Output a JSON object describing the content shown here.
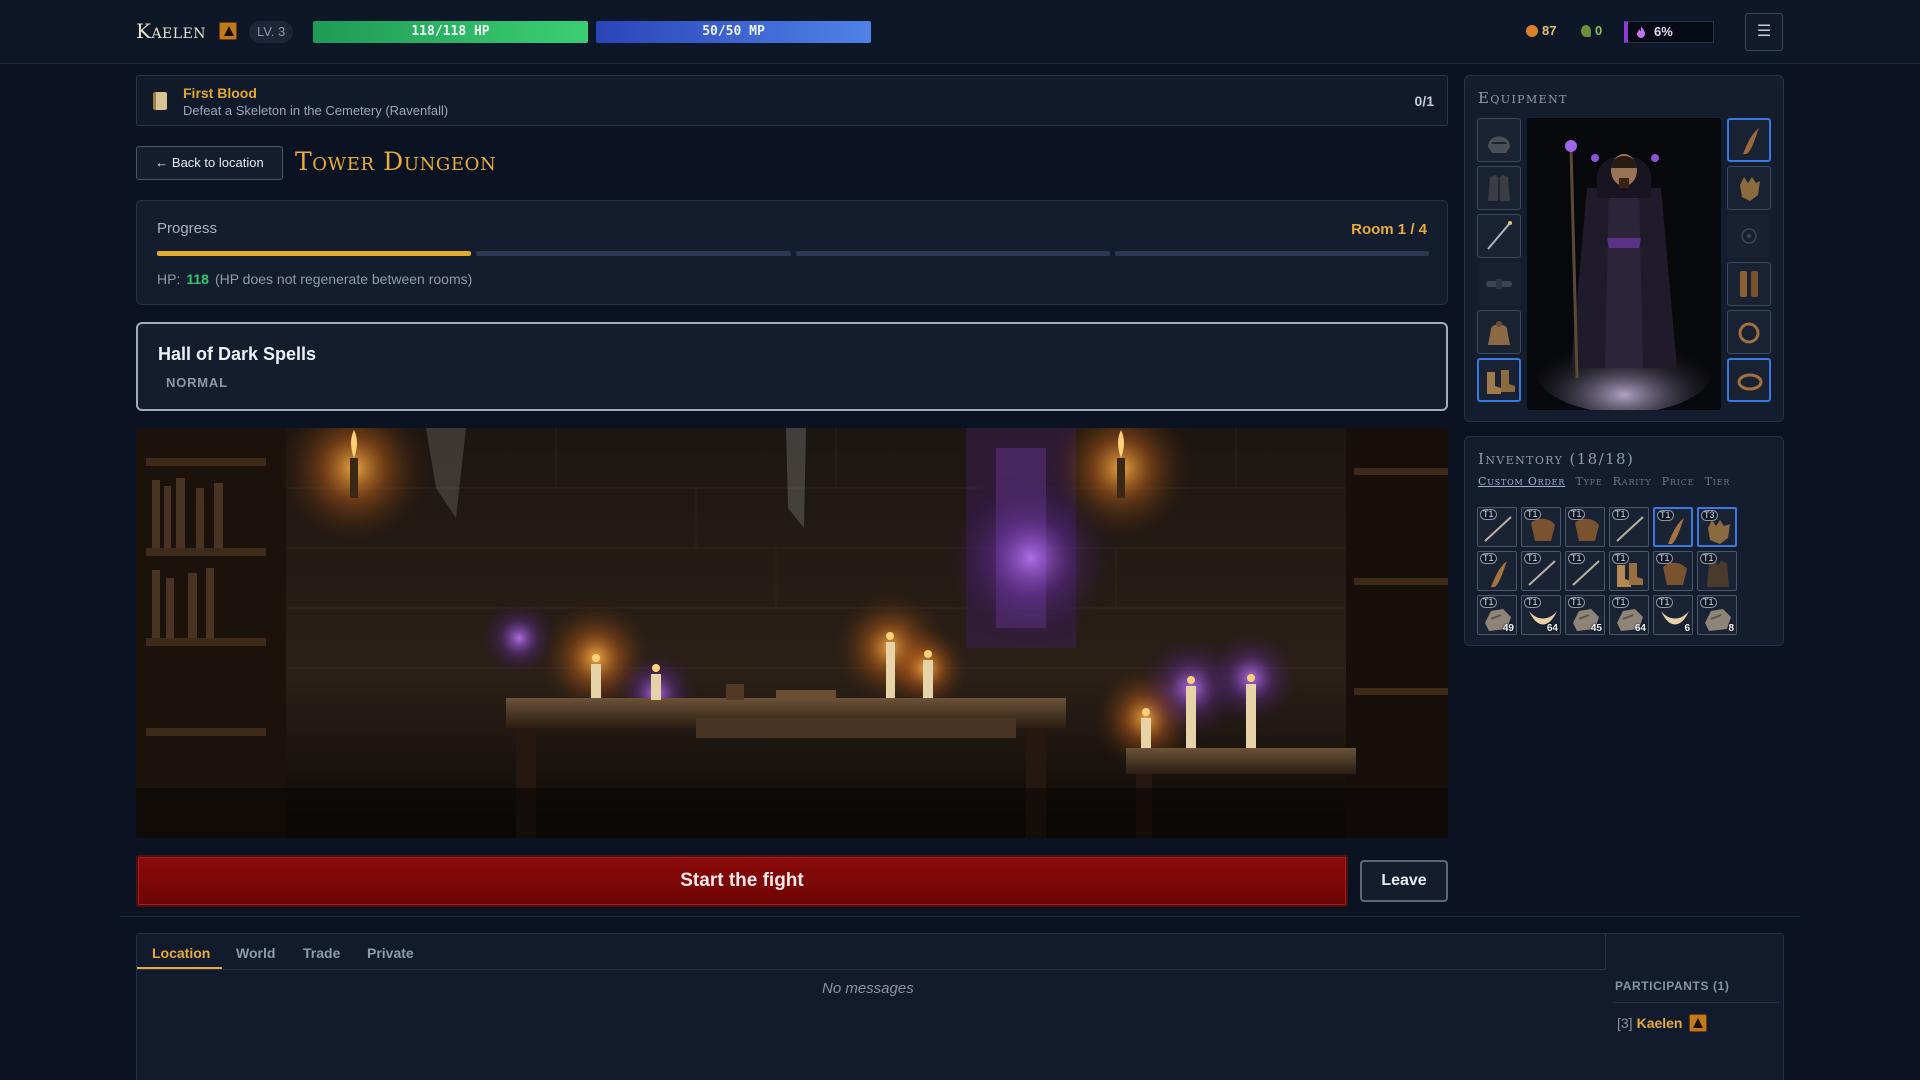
{
  "header": {
    "character_name": "Kaelen",
    "level": "LV. 3",
    "hp": "118/118 HP",
    "mp": "50/50 MP",
    "coins": "87",
    "leaves": "0",
    "xp_percent": "6%",
    "menu_icon": "☰"
  },
  "quest": {
    "title": "First Blood",
    "description": "Defeat a Skeleton in the Cemetery (Ravenfall)",
    "count": "0/1"
  },
  "nav": {
    "back_label": "← Back to location"
  },
  "dungeon": {
    "title": "Tower Dungeon",
    "progress_label": "Progress",
    "room_text": "Room 1 / 4",
    "rooms_total": 4,
    "rooms_done": 1,
    "hp_label": "HP:",
    "hp_value": "118",
    "hp_note": "(HP does not regenerate between rooms)"
  },
  "room": {
    "name": "Hall of Dark Spells",
    "difficulty": "NORMAL"
  },
  "actions": {
    "fight_label": "Start the fight",
    "leave_label": "Leave"
  },
  "chat": {
    "tabs": [
      "Location",
      "World",
      "Trade",
      "Private"
    ],
    "active_tab": "Location",
    "empty_text": "No messages",
    "participants_title": "PARTICIPANTS (1)",
    "participants": [
      {
        "level": "[3]",
        "name": "Kaelen"
      }
    ]
  },
  "equipment": {
    "title": "Equipment",
    "left_slots": [
      "helmet-icon",
      "armor-icon",
      "staff-icon",
      "empty-belt-icon",
      "bag-icon",
      "boots-icon"
    ],
    "right_slots": [
      "horn-icon",
      "gloves-icon",
      "empty-slot-icon",
      "legs-icon",
      "ring-icon",
      "ring-icon"
    ]
  },
  "inventory": {
    "title": "Inventory (18/18)",
    "sort_options": [
      "Custom Order",
      "Type",
      "Rarity",
      "Price",
      "Tier"
    ],
    "active_sort": "Custom Order",
    "items": [
      {
        "tier": "T1",
        "icon": "stick-icon",
        "qty": ""
      },
      {
        "tier": "T1",
        "icon": "leather-icon",
        "qty": ""
      },
      {
        "tier": "T1",
        "icon": "leather-icon",
        "qty": ""
      },
      {
        "tier": "T1",
        "icon": "stick-icon",
        "qty": ""
      },
      {
        "tier": "T1",
        "icon": "horn-icon",
        "qty": ""
      },
      {
        "tier": "T3",
        "icon": "gloves-icon",
        "qty": ""
      },
      {
        "tier": "T1",
        "icon": "horn-icon",
        "qty": ""
      },
      {
        "tier": "T1",
        "icon": "stick-icon",
        "qty": ""
      },
      {
        "tier": "T1",
        "icon": "stick-icon",
        "qty": ""
      },
      {
        "tier": "T1",
        "icon": "boots-icon",
        "qty": ""
      },
      {
        "tier": "T1",
        "icon": "leather-icon",
        "qty": ""
      },
      {
        "tier": "T1",
        "icon": "armor-icon",
        "qty": ""
      },
      {
        "tier": "T1",
        "icon": "ore-icon",
        "qty": "49"
      },
      {
        "tier": "T1",
        "icon": "fang-icon",
        "qty": "64"
      },
      {
        "tier": "T1",
        "icon": "ore-icon",
        "qty": "45"
      },
      {
        "tier": "T1",
        "icon": "ore-icon",
        "qty": "64"
      },
      {
        "tier": "T1",
        "icon": "fang-icon",
        "qty": "6"
      },
      {
        "tier": "T1",
        "icon": "ore-icon",
        "qty": "8"
      }
    ]
  },
  "colors": {
    "accent": "#e8ab3c",
    "hp": "#36c56d",
    "mp": "#4f82e8",
    "fight": "#8c0a0a",
    "rare_border": "#3b78e0"
  }
}
